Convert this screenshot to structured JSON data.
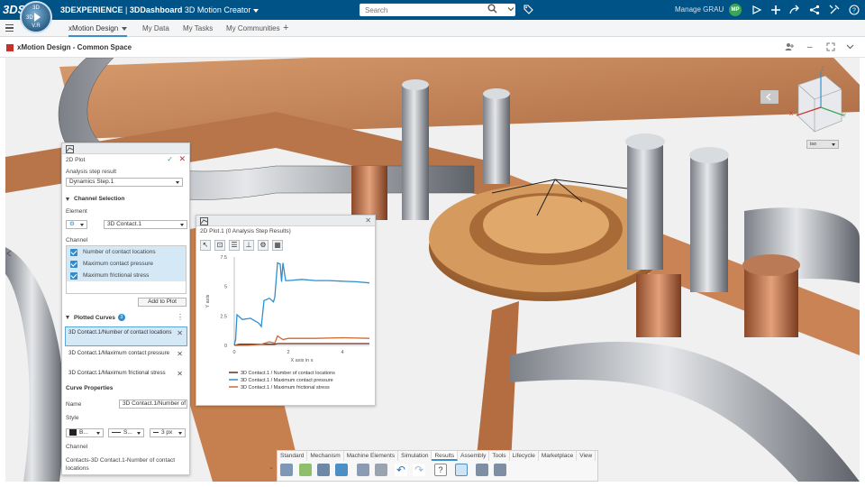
{
  "topbar": {
    "logo": "3DS",
    "compass": {
      "top": "3D",
      "center": "V.R",
      "left": "3D"
    },
    "brand_main": "3DEXPERIENCE",
    "brand_sep": " | ",
    "brand_app": "3DDashboard",
    "brand_role": "3D Motion Creator",
    "search_placeholder": "Search",
    "user_name": "Manage GRAU",
    "avatar_initials": "MP",
    "accent": "#005386"
  },
  "tabs": [
    {
      "label": "xMotion Design",
      "active": true
    },
    {
      "label": "My Data"
    },
    {
      "label": "My Tasks"
    },
    {
      "label": "My Communities"
    }
  ],
  "app": {
    "title": "xMotion Design - Common Space"
  },
  "viewcube": {
    "axes": {
      "z": "Z",
      "x": "X",
      "y": "Y"
    },
    "view_option": "iso"
  },
  "plot_panel": {
    "title": "2D Plot",
    "analysis_label": "Analysis step result",
    "analysis_value": "Dynamics Step.1",
    "channel_selection": "Channel Selection",
    "element_label": "Element",
    "element_value": "3D Contact.1",
    "channel_label": "Channel",
    "channels": [
      "Number of contact locations",
      "Maximum contact pressure",
      "Maximum frictional stress"
    ],
    "add_button": "Add to Plot",
    "plotted_curves": "Plotted Curves",
    "curve_count": "3",
    "curves": [
      "3D Contact.1/Number of contact locations",
      "3D Contact.1/Maximum contact pressure",
      "3D Contact.1/Maximum frictional stress"
    ],
    "curve_properties": "Curve Properties",
    "name_label": "Name",
    "name_value": "3D Contact.1/Number of",
    "style_label": "Style",
    "style_color": "B...",
    "style_line": "S...",
    "style_width": "3 px",
    "channel2_label": "Channel",
    "channel2_value": "Contacts-3D Contact.1-Number of contact locations"
  },
  "chart_window": {
    "title": "2D Plot.1 (0 Analysis Step Results)"
  },
  "chart_data": {
    "type": "line",
    "xlabel": "X axis in s",
    "ylabel": "Y axis",
    "xlim": [
      0,
      5
    ],
    "ylim": [
      0,
      7.5
    ],
    "xticks": [
      "0",
      "2",
      "4"
    ],
    "yticks": [
      "0",
      "2.5",
      "5",
      "7.5"
    ],
    "series": [
      {
        "name": "3D Contact.1 / Number of contact locations",
        "color": "#6b2b1f",
        "x": [
          0,
          0.1,
          0.2,
          0.5,
          1.0,
          1.5,
          1.6,
          1.7,
          2.0,
          3.0,
          4.0,
          5.0
        ],
        "y": [
          0,
          0.05,
          0.1,
          0.1,
          0.1,
          0.1,
          0.15,
          0.15,
          0.15,
          0.15,
          0.15,
          0.15
        ]
      },
      {
        "name": "3D Contact.1 / Maximum contact pressure",
        "color": "#2f8fd0",
        "x": [
          0,
          0.05,
          0.1,
          0.3,
          0.6,
          0.9,
          1.0,
          1.1,
          1.3,
          1.45,
          1.5,
          1.6,
          1.7,
          1.75,
          1.8,
          1.9,
          2.0,
          2.5,
          3.0,
          3.5,
          4.0,
          4.5,
          5.0
        ],
        "y": [
          0,
          0.5,
          2.6,
          2.2,
          2.3,
          1.9,
          1.6,
          3.8,
          4.0,
          3.7,
          4.1,
          7.0,
          6.9,
          5.4,
          7.0,
          5.5,
          5.5,
          5.6,
          5.5,
          5.5,
          5.45,
          5.4,
          5.3
        ]
      },
      {
        "name": "3D Contact.1 / Maximum frictional stress",
        "color": "#d06a33",
        "x": [
          0,
          0.5,
          1.0,
          1.3,
          1.5,
          1.6,
          1.8,
          2.0,
          3.0,
          4.0,
          5.0
        ],
        "y": [
          0,
          0,
          0.1,
          0.3,
          0.2,
          0.8,
          0.5,
          0.6,
          0.6,
          0.65,
          0.6
        ]
      }
    ],
    "legend": "bottom"
  },
  "bottom_toolbar": {
    "tabs": [
      "Standard",
      "Mechanism",
      "Machine Elements",
      "Simulation",
      "Results",
      "Assembly",
      "Tools",
      "Lifecycle",
      "Marketplace",
      "View"
    ],
    "active": "Results"
  }
}
